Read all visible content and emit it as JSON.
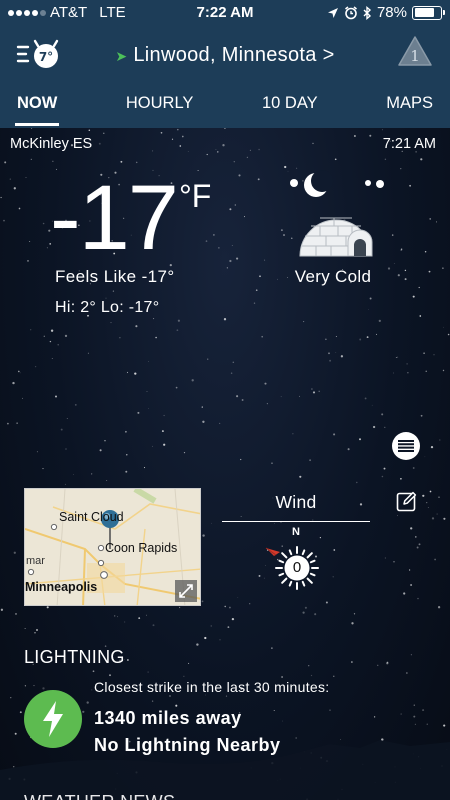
{
  "status_bar": {
    "carrier": "AT&T",
    "network": "LTE",
    "time": "7:22 AM",
    "battery": "78%",
    "battery_level": 0.78
  },
  "header": {
    "location": "Linwood, Minnesota",
    "chevron": ">",
    "alert_count": "1"
  },
  "tabs": [
    {
      "label": "NOW",
      "active": true
    },
    {
      "label": "HOURLY",
      "active": false
    },
    {
      "label": "10 DAY",
      "active": false
    },
    {
      "label": "MAPS",
      "active": false
    }
  ],
  "current": {
    "station": "McKinley ES",
    "observed_time": "7:21 AM",
    "temperature": "-17",
    "unit": "°F",
    "feels_like": "Feels Like -17°",
    "hi_lo": "Hi: 2° Lo: -17°",
    "condition": "Very Cold",
    "condition_icon": "igloo-night-icon"
  },
  "map": {
    "labels": {
      "saint_cloud": "Saint Cloud",
      "coon_rapids": "Coon Rapids",
      "mar": "mar",
      "minneapolis": "Minneapolis"
    }
  },
  "wind": {
    "title": "Wind",
    "north": "N",
    "speed": "0",
    "direction_icon": "compass-icon"
  },
  "lightning": {
    "title": "LIGHTNING",
    "closest_label": "Closest strike in the last 30 minutes:",
    "distance": "1340 miles away",
    "status": "No Lightning Nearby"
  },
  "next_section": {
    "title": "WEATHER NEWS"
  },
  "colors": {
    "header_bg": "#1d3d58",
    "lightning_green": "#5dbb50",
    "location_arrow": "#4cc05a"
  }
}
